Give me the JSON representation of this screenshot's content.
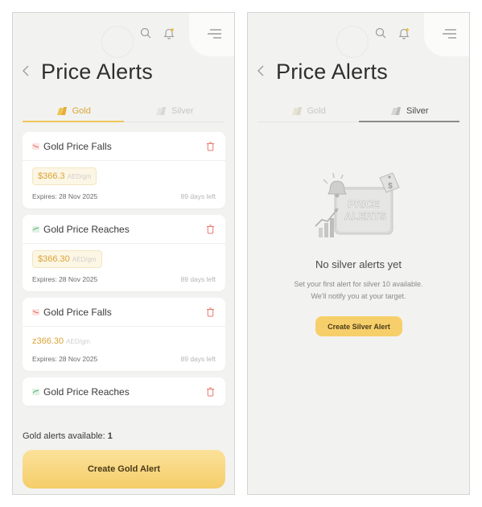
{
  "gold_screen": {
    "title": "Price Alerts",
    "tabs": [
      {
        "label": "Gold",
        "icon": "gold-bars-icon",
        "active": true
      },
      {
        "label": "Silver",
        "icon": "silver-bars-icon",
        "active": false
      }
    ],
    "alerts": [
      {
        "title": "Gold Price Falls",
        "type": "falls",
        "price": "$366.3",
        "unit": "AED/gm",
        "expires": "Expires: 28 Nov 2025",
        "days_left": "89 days left"
      },
      {
        "title": "Gold Price Reaches",
        "type": "reaches",
        "price": "$366.30",
        "unit": "AED/gm",
        "expires": "Expires: 28 Nov 2025",
        "days_left": "89 days left"
      },
      {
        "title": "Gold Price Falls",
        "type": "falls",
        "price": "z366.30",
        "unit": "AED/gm",
        "expires": "Expires: 28 Nov 2025",
        "days_left": "89 days left"
      },
      {
        "title": "Gold Price Reaches",
        "type": "reaches"
      }
    ],
    "available_label": "Gold alerts available:",
    "available_count": "1",
    "create_button": "Create  Gold Alert"
  },
  "silver_screen": {
    "title": "Price Alerts",
    "tabs": [
      {
        "label": "Gold",
        "icon": "gold-bars-icon",
        "active": false
      },
      {
        "label": "Silver",
        "icon": "silver-bars-icon",
        "active": true
      }
    ],
    "illustration_text": [
      "PRICE",
      "ALERTS"
    ],
    "empty_title": "No silver alerts yet",
    "empty_desc_line1": "Set your first alert for silver 10 available.",
    "empty_desc_line2": "We'll notify you at your target.",
    "create_button": "Create  Silver Alert"
  },
  "colors": {
    "gold_accent": "#dba336",
    "button_gold": "#f6cf6b",
    "background": "#f2f2f0",
    "fall_icon": "#e0685d",
    "rise_icon": "#5aab6e"
  }
}
